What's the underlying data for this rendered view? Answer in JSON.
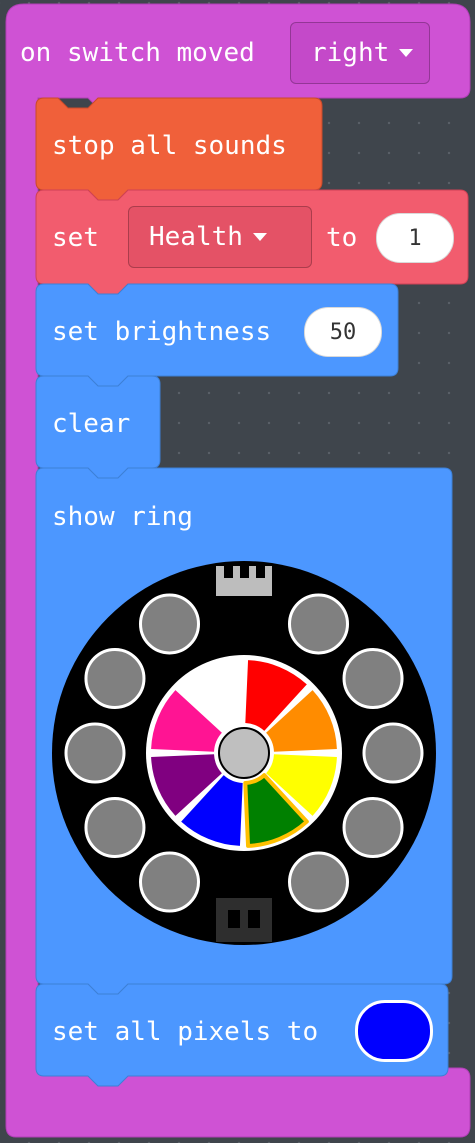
{
  "event": {
    "label": "on switch moved",
    "dropdown": "right"
  },
  "blocks": {
    "stop_sounds": {
      "label": "stop all sounds"
    },
    "set_var": {
      "label_set": "set",
      "variable": "Health",
      "label_to": "to",
      "value": "1"
    },
    "brightness": {
      "label": "set brightness",
      "value": "50"
    },
    "clear": {
      "label": "clear"
    },
    "show_ring": {
      "label": "show ring"
    },
    "set_pixels": {
      "label": "set all pixels to",
      "color": "#0000ff"
    }
  },
  "ring": {
    "outer_pixel_color": "#808080",
    "center_color": "#bfbfbf",
    "segments": [
      {
        "name": "white",
        "color": "#ffffff"
      },
      {
        "name": "red",
        "color": "#ff0000"
      },
      {
        "name": "orange",
        "color": "#ff8c00"
      },
      {
        "name": "yellow",
        "color": "#ffff00"
      },
      {
        "name": "green",
        "color": "#008000",
        "selected": true
      },
      {
        "name": "blue",
        "color": "#0000ff"
      },
      {
        "name": "purple",
        "color": "#800080"
      },
      {
        "name": "pink",
        "color": "#ff1493"
      }
    ],
    "selected_outline": "#ffc000"
  },
  "colors": {
    "event": "#cf52d4",
    "sound": "#f0603a",
    "variable": "#f25c6e",
    "light": "#4c97ff"
  }
}
